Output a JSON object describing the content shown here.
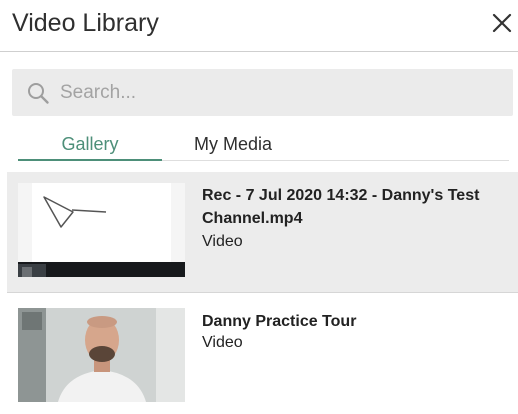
{
  "header": {
    "title": "Video Library",
    "close_icon": "close-icon"
  },
  "search": {
    "placeholder": "Search...",
    "value": "",
    "icon": "search-icon"
  },
  "tabs": [
    {
      "label": "Gallery",
      "active": true
    },
    {
      "label": "My Media",
      "active": false
    }
  ],
  "items": [
    {
      "title": "Rec - 7 Jul 2020 14:32 - Danny's Test Channel.mp4",
      "type": "Video",
      "selected": true
    },
    {
      "title": "Danny Practice Tour",
      "type": "Video",
      "selected": false
    }
  ],
  "colors": {
    "accent": "#4d8f79",
    "search_bg": "#ebebeb",
    "selected_row_bg": "#ececec"
  }
}
